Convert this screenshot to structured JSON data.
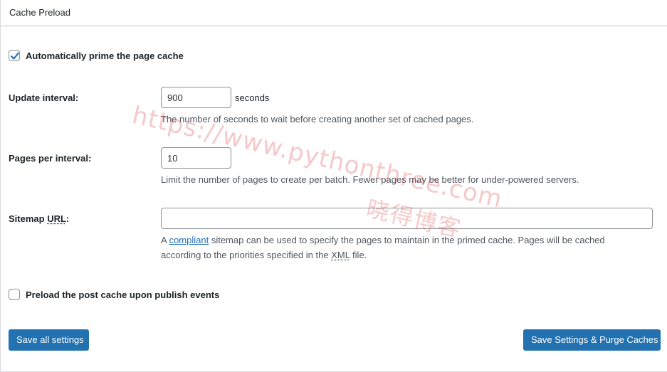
{
  "panel": {
    "title": "Cache Preload"
  },
  "auto_prime": {
    "label": "Automatically prime the page cache",
    "checked": true
  },
  "update_interval": {
    "label": "Update interval:",
    "value": "900",
    "suffix": "seconds",
    "description": "The number of seconds to wait before creating another set of cached pages."
  },
  "pages_per_interval": {
    "label": "Pages per interval:",
    "value": "10",
    "description": "Limit the number of pages to create per batch. Fewer pages may be better for under-powered servers."
  },
  "sitemap": {
    "label_prefix": "Sitemap ",
    "label_abbr": "URL",
    "label_suffix": ":",
    "value": "",
    "desc_a": "A ",
    "desc_link": "compliant",
    "desc_b": " sitemap can be used to specify the pages to maintain in the primed cache. Pages will be cached",
    "desc_c": "according to the priorities specified in the ",
    "desc_abbr": "XML",
    "desc_d": " file."
  },
  "post_cache": {
    "label": "Preload the post cache upon publish events",
    "checked": false
  },
  "buttons": {
    "save_all": "Save all settings",
    "save_purge": "Save Settings & Purge Caches"
  },
  "watermark": {
    "line1": "https://www.pythonthree.com",
    "line2": "晓得博客"
  },
  "colors": {
    "accent": "#2271b1",
    "checkmark": "#2271b1",
    "watermark": "#dc3c3c"
  }
}
